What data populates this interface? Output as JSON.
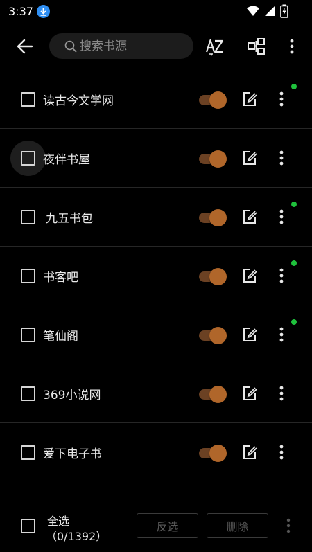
{
  "status_bar": {
    "time": "3:37"
  },
  "toolbar": {
    "search_placeholder": "搜索书源"
  },
  "sources": [
    {
      "name": "读古今文学网",
      "enabled": true,
      "has_dot": true
    },
    {
      "name": "夜伴书屋",
      "enabled": true,
      "has_dot": false
    },
    {
      "name": "九五书包",
      "enabled": true,
      "has_dot": true
    },
    {
      "name": "书客吧",
      "enabled": true,
      "has_dot": true
    },
    {
      "name": "笔仙阁",
      "enabled": true,
      "has_dot": true
    },
    {
      "name": "369小说网",
      "enabled": true,
      "has_dot": false
    },
    {
      "name": "爱下电子书",
      "enabled": true,
      "has_dot": false
    }
  ],
  "bottom_bar": {
    "select_all_label": "全选",
    "count": "（0/1392）",
    "invert_label": "反选",
    "delete_label": "删除"
  },
  "colors": {
    "accent": "#b0662a",
    "switch_track": "#6b4123",
    "status_dot": "#1fc13c",
    "download_badge": "#2f8ff3"
  }
}
